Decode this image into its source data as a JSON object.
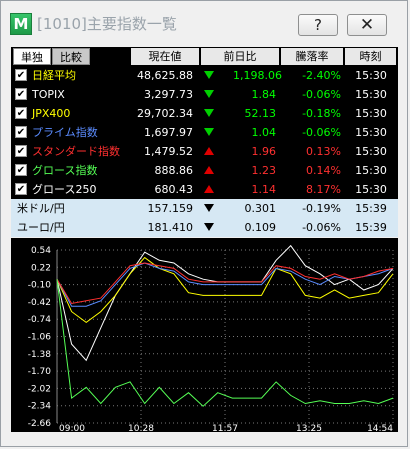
{
  "window": {
    "title": "[1010]主要指数一覧",
    "help_label": "?",
    "close_label": "✕",
    "app_icon_letter": "M"
  },
  "table": {
    "tabs": [
      "単独",
      "比較"
    ],
    "headers": [
      "現在値",
      "前日比",
      "騰落率",
      "時刻"
    ],
    "rows": [
      {
        "name": "日経平均",
        "value": "48,625.88",
        "change": "1,198.06",
        "rate": "-2.40%",
        "time": "15:30",
        "color": "#ffff00",
        "dir": "down"
      },
      {
        "name": "TOPIX",
        "value": "3,297.73",
        "change": "1.84",
        "rate": "-0.06%",
        "time": "15:30",
        "color": "#ffffff",
        "dir": "down"
      },
      {
        "name": "JPX400",
        "value": "29,702.34",
        "change": "52.13",
        "rate": "-0.18%",
        "time": "15:30",
        "color": "#ffff00",
        "dir": "down"
      },
      {
        "name": "プライム指数",
        "value": "1,697.97",
        "change": "1.04",
        "rate": "-0.06%",
        "time": "15:30",
        "color": "#5b8cff",
        "dir": "down"
      },
      {
        "name": "スタンダード指数",
        "value": "1,479.52",
        "change": "1.96",
        "rate": "0.13%",
        "time": "15:30",
        "color": "#ff3030",
        "dir": "up"
      },
      {
        "name": "グロース指数",
        "value": "888.86",
        "change": "1.23",
        "rate": "0.14%",
        "time": "15:30",
        "color": "#55ff55",
        "dir": "up"
      },
      {
        "name": "グロース250",
        "value": "680.43",
        "change": "1.14",
        "rate": "8.17%",
        "time": "15:30",
        "color": "#ffffff",
        "dir": "up"
      }
    ],
    "fx": [
      {
        "name": "米ドル/円",
        "value": "157.159",
        "change": "0.301",
        "rate": "-0.19%",
        "time": "15:39"
      },
      {
        "name": "ユーロ/円",
        "value": "181.410",
        "change": "0.109",
        "rate": "-0.06%",
        "time": "15:39"
      }
    ],
    "colors": {
      "up": "#e00000",
      "down_green": "#00d000",
      "negative_rate": "#00ff00",
      "positive_rate": "#ff3030"
    }
  },
  "chart_data": {
    "type": "line",
    "y_ticks": [
      "0.54",
      "0.22",
      "-0.10",
      "-0.42",
      "-0.74",
      "-1.06",
      "-1.38",
      "-1.70",
      "-2.02",
      "-2.34",
      "-2.66"
    ],
    "x_ticks": [
      "09:00",
      "10:28",
      "11:57",
      "13:25",
      "14:54"
    ],
    "ylim": [
      -2.66,
      0.54
    ],
    "grid": true,
    "series": [
      {
        "color": "#ffffff",
        "values": [
          0.0,
          -1.2,
          -1.5,
          -0.9,
          -0.3,
          0.1,
          0.5,
          0.35,
          0.3,
          0.1,
          0.0,
          -0.05,
          -0.05,
          -0.05,
          -0.05,
          0.35,
          0.62,
          0.25,
          0.1,
          -0.1,
          0.0,
          -0.2,
          -0.1,
          0.2
        ]
      },
      {
        "color": "#ffff00",
        "values": [
          0.0,
          -0.6,
          -0.8,
          -0.6,
          -0.3,
          0.1,
          0.4,
          0.2,
          0.1,
          -0.25,
          -0.3,
          -0.3,
          -0.3,
          -0.3,
          -0.3,
          0.2,
          0.1,
          -0.3,
          -0.35,
          -0.2,
          -0.35,
          -0.3,
          -0.25,
          0.1
        ]
      },
      {
        "color": "#5b8cff",
        "values": [
          0.0,
          -0.5,
          -0.5,
          -0.4,
          -0.1,
          0.2,
          0.3,
          0.2,
          0.15,
          -0.05,
          -0.1,
          -0.1,
          -0.1,
          -0.1,
          -0.1,
          0.2,
          0.15,
          0.0,
          -0.1,
          0.05,
          0.0,
          0.05,
          0.1,
          0.2
        ]
      },
      {
        "color": "#ff3030",
        "values": [
          0.0,
          -0.45,
          -0.4,
          -0.35,
          -0.05,
          0.25,
          0.3,
          0.25,
          0.2,
          0.0,
          -0.05,
          -0.05,
          -0.05,
          -0.05,
          -0.05,
          0.25,
          0.2,
          0.05,
          0.0,
          0.1,
          0.0,
          0.05,
          0.15,
          0.2
        ]
      },
      {
        "color": "#55ff55",
        "values": [
          0.0,
          -2.2,
          -2.0,
          -2.3,
          -2.0,
          -1.9,
          -2.3,
          -2.0,
          -2.3,
          -2.1,
          -2.35,
          -2.1,
          -2.2,
          -2.2,
          -2.2,
          -1.9,
          -2.15,
          -2.3,
          -2.25,
          -2.3,
          -2.3,
          -2.25,
          -2.3,
          -2.2
        ]
      }
    ]
  }
}
